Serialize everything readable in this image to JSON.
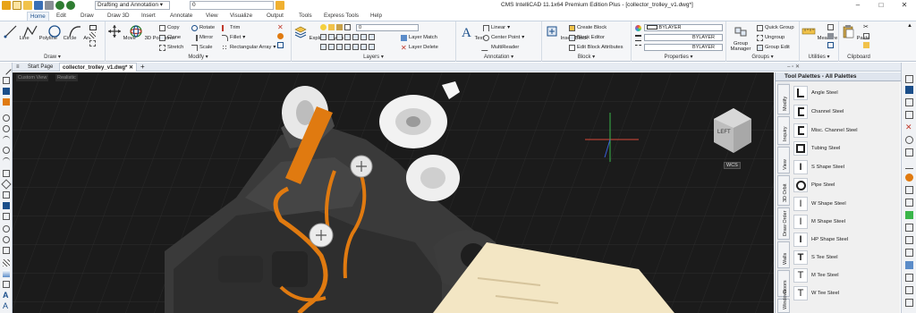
{
  "titlebar": {
    "title": "CMS IntelliCAD 11.1x64 Premium Edition Plus - [collector_trolley_v1.dwg*]",
    "workspace": "Drafting and Annotation",
    "layer_value": "0",
    "controls": [
      "–",
      "□",
      "✕"
    ]
  },
  "menu_tabs": [
    "Home",
    "Edit",
    "Draw",
    "Draw 3D",
    "Insert",
    "Annotate",
    "View",
    "Visualize",
    "Output",
    "Tools",
    "Express Tools",
    "Help"
  ],
  "ribbon": {
    "draw": {
      "label": "Draw ▾",
      "buttons": [
        "Line",
        "Polyline",
        "Circle",
        "Arc"
      ]
    },
    "modify": {
      "label": "Modify ▾",
      "big": [
        "Move",
        "3D Positioner"
      ],
      "small": [
        "Copy",
        "Rotate",
        "Trim",
        "Clone",
        "Mirror",
        "Fillet",
        "Stretch",
        "Scale",
        "Rectangular Array"
      ]
    },
    "layers": {
      "label": "Layers ▾",
      "big": "Explore Layers",
      "layer_value": "0",
      "small": [
        "Layer Match",
        "Layer Delete"
      ]
    },
    "annotation": {
      "label": "Annotation ▾",
      "big": "Text",
      "small": [
        "Linear",
        "Center Point",
        "MultiReader"
      ]
    },
    "block": {
      "label": "Block ▾",
      "big": "Insert Block",
      "small": [
        "Create Block",
        "Block Editor",
        "Edit Block Attributes"
      ]
    },
    "properties": {
      "label": "Properties ▾",
      "values": [
        "BYLAYER",
        "BYLAYER",
        "BYLAYER"
      ]
    },
    "groups": {
      "label": "Groups ▾",
      "big": "Group Manager",
      "small": [
        "Quick Group",
        "Ungroup",
        "Group Edit"
      ]
    },
    "utilities": {
      "label": "Utilities ▾",
      "big": "Measure"
    },
    "clipboard": {
      "label": "Clipboard",
      "big": "Paste"
    }
  },
  "doc_tabs": [
    "Start Page",
    "collector_trolley_v1.dwg*",
    "+"
  ],
  "viewport": {
    "labels": [
      "Custom View",
      "Realistic"
    ],
    "viewcube_label": "LEFT",
    "wcs_label": "WCS"
  },
  "palette": {
    "title": "Tool Palettes - All Palettes",
    "tabs": [
      "Modify",
      "Inquiry",
      "View",
      "3D Orbit",
      "Draw Order",
      "Walls",
      "Doors",
      "Windows"
    ],
    "items": [
      "Angle Steel",
      "Channel Steel",
      "Misc. Channel Steel",
      "Tubing Steel",
      "S Shape Steel",
      "Pipe Steel",
      "W Shape Steel",
      "M Shape Steel",
      "HP Shape Steel",
      "S Tee Steel",
      "M Tee Steel",
      "W Tee Steel"
    ]
  },
  "colors": {
    "accent": "#1a4e8a",
    "orange": "#e07a10",
    "viewport_bg": "#1b1b1b"
  }
}
